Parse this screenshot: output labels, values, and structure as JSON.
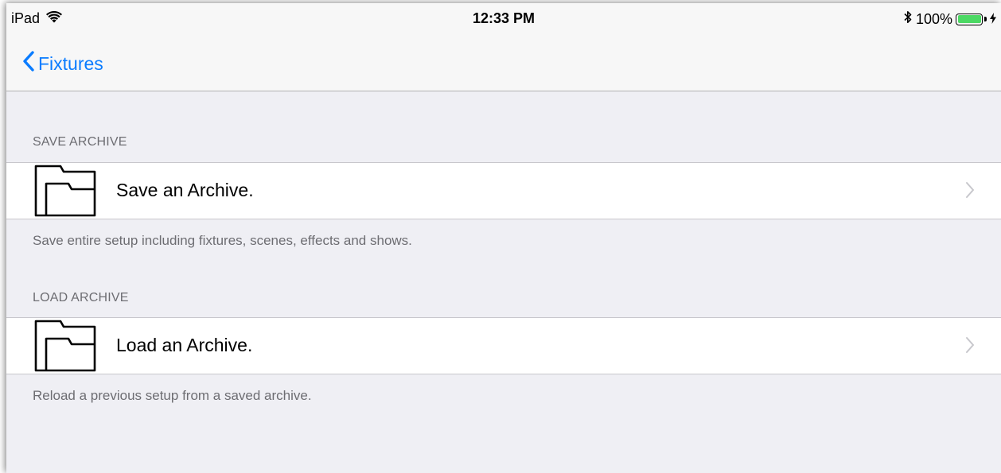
{
  "status_bar": {
    "device": "iPad",
    "time": "12:33 PM",
    "battery_percent": "100%",
    "battery_level": 1.0,
    "battery_color": "#4cd964"
  },
  "nav": {
    "back_label": "Fixtures",
    "tint_color": "#0a7cff"
  },
  "sections": [
    {
      "header": "SAVE ARCHIVE",
      "cell_title": "Save an Archive.",
      "footer": "Save entire setup including fixtures, scenes, effects and shows.",
      "icon": "folder-icon"
    },
    {
      "header": "LOAD ARCHIVE",
      "cell_title": "Load an Archive.",
      "footer": "Reload a previous setup from a saved archive.",
      "icon": "folder-icon"
    }
  ]
}
